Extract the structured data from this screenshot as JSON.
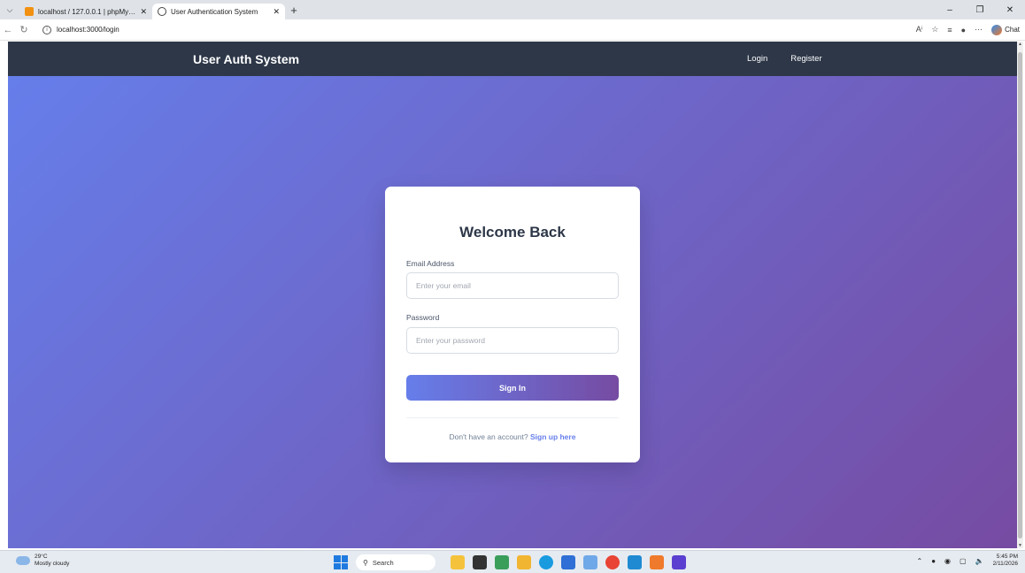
{
  "browser": {
    "tabs": [
      {
        "title": "localhost / 127.0.0.1 | phpMyAdmin",
        "active": false,
        "favicon_color": "#f29111"
      },
      {
        "title": "User Authentication System",
        "active": true,
        "favicon_color": "#444444"
      }
    ],
    "url": "localhost:3000/login",
    "chat_label": "Chat"
  },
  "navbar": {
    "brand": "User Auth System",
    "links": [
      "Login",
      "Register"
    ]
  },
  "login": {
    "heading": "Welcome Back",
    "email_label": "Email Address",
    "email_placeholder": "Enter your email",
    "password_label": "Password",
    "password_placeholder": "Enter your password",
    "submit_label": "Sign In",
    "footer_text": "Don't have an account?",
    "footer_link": "Sign up here"
  },
  "colors": {
    "navbar_bg": "#2d3748",
    "gradient_start": "#667eea",
    "gradient_end": "#764ba2",
    "accent": "#667eea"
  },
  "taskbar": {
    "weather_temp": "29°C",
    "weather_desc": "Mostly cloudy",
    "search_label": "Search",
    "time": "5:45 PM",
    "date": "2/11/2026",
    "apps": [
      {
        "icon": "file-explorer-icon",
        "color": "#f5c33b"
      },
      {
        "icon": "edge-icon",
        "color": "#1a9be0"
      },
      {
        "icon": "store-icon",
        "color": "#2f6fd6"
      },
      {
        "icon": "photos-icon",
        "color": "#6fa8e8"
      },
      {
        "icon": "chrome-icon",
        "color": "#e84335"
      },
      {
        "icon": "vscode-icon",
        "color": "#1f8ad2"
      },
      {
        "icon": "xampp-icon",
        "color": "#f07a2b"
      },
      {
        "icon": "app-icon",
        "color": "#5a3fd0"
      }
    ]
  }
}
